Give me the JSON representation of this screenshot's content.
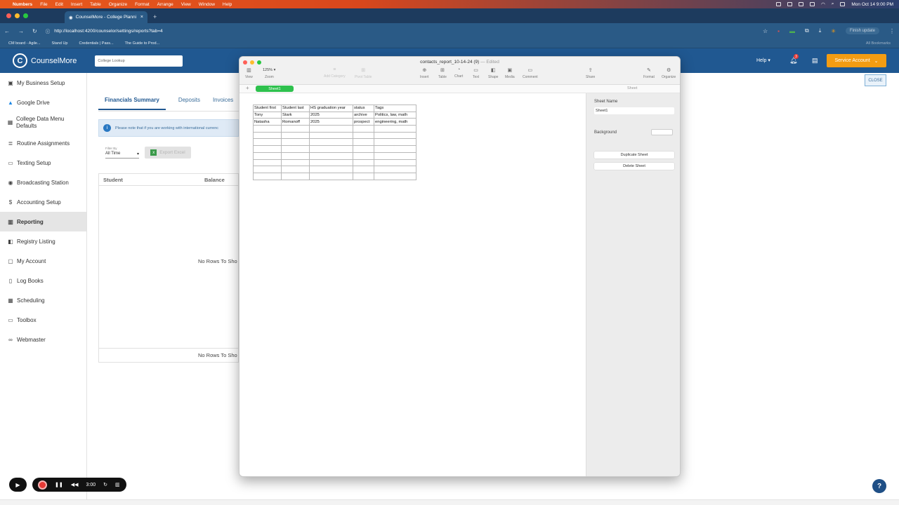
{
  "menubar": {
    "app": "Numbers",
    "items": [
      "File",
      "Edit",
      "Insert",
      "Table",
      "Organize",
      "Format",
      "Arrange",
      "View",
      "Window",
      "Help"
    ],
    "datetime": "Mon Oct 14  9:00 PM"
  },
  "browser": {
    "tab_title": "CounselMore - College Planni",
    "url": "http://localhost:4200/counselor/settings/reports?tab=4",
    "finish_update": "Finish update",
    "bookmarks": [
      "CM board - Agile...",
      "Stand Up",
      "Credentials | Pass...",
      "The Guide to Prod..."
    ],
    "all_bookmarks": "All Bookmarks"
  },
  "header": {
    "brand": "CounselMore",
    "search_placeholder": "College Lookup",
    "help": "Help",
    "notif_count": "3",
    "account": "Service Account"
  },
  "sidebar": {
    "items": [
      {
        "label": "My Business Setup",
        "icon": "briefcase-icon"
      },
      {
        "label": "Google Drive",
        "icon": "google-drive-icon"
      },
      {
        "label": "College Data Menu Defaults",
        "icon": "table-icon"
      },
      {
        "label": "Routine Assignments",
        "icon": "list-icon"
      },
      {
        "label": "Texting Setup",
        "icon": "chat-icon"
      },
      {
        "label": "Broadcasting Station",
        "icon": "broadcast-icon"
      },
      {
        "label": "Accounting Setup",
        "icon": "dollar-icon"
      },
      {
        "label": "Reporting",
        "icon": "chart-icon"
      },
      {
        "label": "Registry Listing",
        "icon": "registry-icon"
      },
      {
        "label": "My Account",
        "icon": "account-icon"
      },
      {
        "label": "Log Books",
        "icon": "book-icon"
      },
      {
        "label": "Scheduling",
        "icon": "calendar-icon"
      },
      {
        "label": "Toolbox",
        "icon": "toolbox-icon"
      },
      {
        "label": "Webmaster",
        "icon": "link-icon"
      }
    ]
  },
  "main": {
    "close": "CLOSE",
    "tabs": [
      "Financials Summary",
      "Deposits",
      "Invoices"
    ],
    "notice": "Please note that if you are working with international currenc",
    "filter_label": "Filter By",
    "filter_value": "All Time",
    "export": "Export Excel",
    "grid_headers": [
      "Student",
      "Balance"
    ],
    "no_rows": "No Rows To Sho"
  },
  "numbers": {
    "title": "contacts_report_10-14-24 (9)",
    "edited": "— Edited",
    "zoom": "125%",
    "tools": {
      "view": "View",
      "zoom": "Zoom",
      "add_category": "Add Category",
      "pivot_table": "Pivot Table",
      "insert": "Insert",
      "table": "Table",
      "chart": "Chart",
      "text": "Text",
      "shape": "Shape",
      "media": "Media",
      "comment": "Comment",
      "share": "Share",
      "format": "Format",
      "organize": "Organize"
    },
    "sheet_tab": "Sheet1",
    "inspector_tab": "Sheet",
    "sheet_name_label": "Sheet Name",
    "sheet_name_value": "Sheet1",
    "background_label": "Background",
    "duplicate": "Duplicate Sheet",
    "delete": "Delete Sheet",
    "table_header": [
      "Student first",
      "Student last",
      "HS graduation year",
      "status",
      "Tags"
    ],
    "table_rows": [
      [
        "Tony",
        "Stark",
        "2025",
        "archive",
        "Politics, law, math"
      ],
      [
        "Natasha",
        "Romanoff",
        "2025",
        "prospect",
        "engineering, math"
      ]
    ]
  },
  "recorder": {
    "time": "3:00"
  }
}
